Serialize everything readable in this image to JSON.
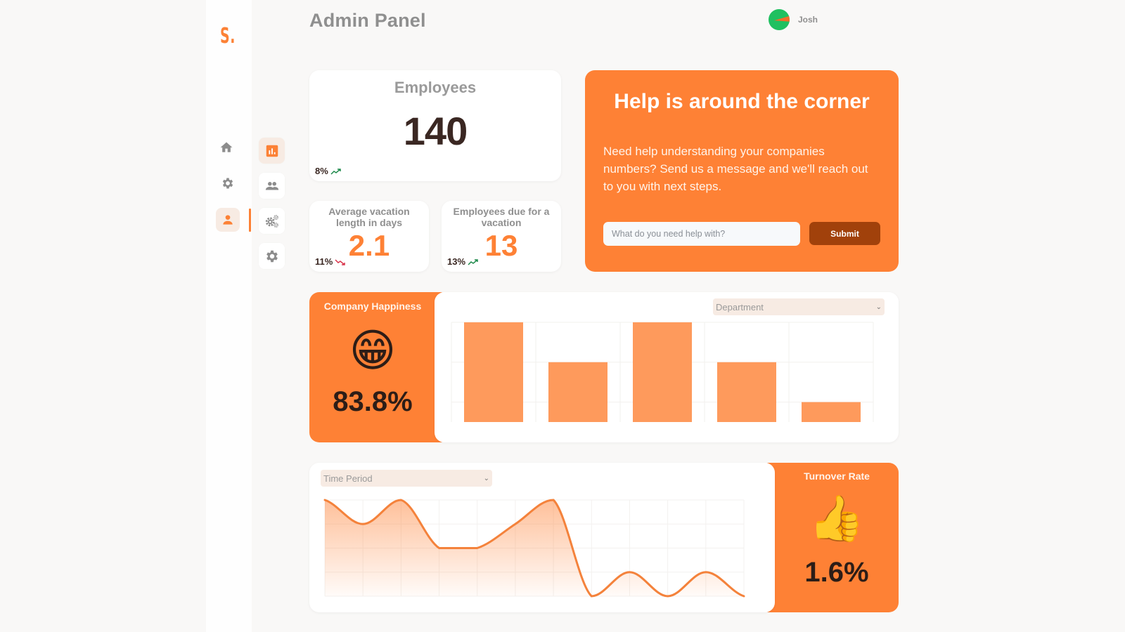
{
  "app": {
    "logo": "S.",
    "title": "Admin Panel",
    "user": {
      "name": "Josh"
    }
  },
  "nav": {
    "primary": [
      {
        "name": "home",
        "icon": "home-icon",
        "active": false
      },
      {
        "name": "settings",
        "icon": "gear-icon",
        "active": false
      },
      {
        "name": "profile",
        "icon": "user-icon",
        "active": true
      }
    ],
    "secondary": [
      {
        "name": "analytics",
        "icon": "bar-chart-icon",
        "active": true
      },
      {
        "name": "team",
        "icon": "people-icon",
        "active": false
      },
      {
        "name": "advanced-settings",
        "icon": "gears-icon",
        "active": false
      },
      {
        "name": "settings",
        "icon": "gear-icon",
        "active": false
      }
    ]
  },
  "stats": {
    "employees": {
      "title": "Employees",
      "value": "140",
      "trend": "8%",
      "trend_dir": "up"
    },
    "avg_vacation": {
      "title": "Average vacation length in days",
      "value": "2.1",
      "trend": "11%",
      "trend_dir": "down"
    },
    "due_vacation": {
      "title": "Employees due for a vacation",
      "value": "13",
      "trend": "13%",
      "trend_dir": "up"
    }
  },
  "help": {
    "title": "Help is around the corner",
    "text": "Need help understanding your companies numbers? Send us a message and we'll reach out to you with next steps.",
    "input_placeholder": "What do you need help with?",
    "input_value": "",
    "submit_label": "Submit"
  },
  "happiness": {
    "title": "Company Happiness",
    "emoji": "😁",
    "value": "83.8%"
  },
  "turnover": {
    "title": "Turnover Rate",
    "emoji": "👍",
    "value": "1.6%"
  },
  "filters": {
    "department": "Department",
    "time_period": "Time Period"
  },
  "colors": {
    "accent": "#fe8135",
    "bar": "#fe9a5c",
    "line": "#f4823b",
    "trend_up": "#1f8a4c",
    "trend_down": "#d9334a",
    "submit": "#a1410b",
    "dark_text": "#2c1d17"
  },
  "chart_data": [
    {
      "type": "bar",
      "title": "",
      "categories": [
        "",
        "",
        "",
        "",
        ""
      ],
      "values": [
        5,
        3,
        5,
        3,
        1
      ],
      "xlabel": "",
      "ylabel": "",
      "ylim": [
        0,
        5
      ],
      "gridlines_y": [
        1,
        3,
        5
      ],
      "grid": true,
      "legend": "none"
    },
    {
      "type": "area",
      "title": "",
      "x": [
        1,
        2,
        3,
        4,
        5,
        6,
        7,
        8,
        9,
        10,
        11,
        12
      ],
      "values": [
        4,
        3,
        4,
        2,
        2,
        3,
        4,
        0,
        1,
        0,
        1,
        0
      ],
      "xlabel": "",
      "ylabel": "",
      "ylim": [
        0,
        4
      ],
      "grid": true,
      "legend": "none"
    }
  ]
}
